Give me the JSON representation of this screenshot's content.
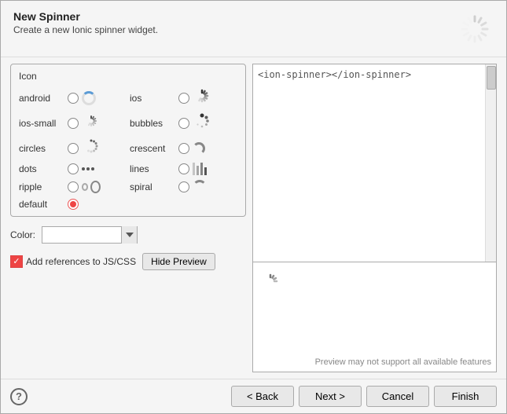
{
  "dialog": {
    "title": "New Spinner",
    "subtitle": "Create a new Ionic spinner widget.",
    "icon_group_label": "Icon",
    "icons": [
      {
        "id": "android",
        "label": "android",
        "col": 0
      },
      {
        "id": "ios",
        "label": "ios",
        "col": 1
      },
      {
        "id": "ios-small",
        "label": "ios-small",
        "col": 0
      },
      {
        "id": "bubbles",
        "label": "bubbles",
        "col": 1
      },
      {
        "id": "circles",
        "label": "circles",
        "col": 0
      },
      {
        "id": "crescent",
        "label": "crescent",
        "col": 1
      },
      {
        "id": "dots",
        "label": "dots",
        "col": 0
      },
      {
        "id": "lines",
        "label": "lines",
        "col": 1
      },
      {
        "id": "ripple",
        "label": "ripple",
        "col": 0
      },
      {
        "id": "spiral",
        "label": "spiral",
        "col": 1
      },
      {
        "id": "default",
        "label": "default",
        "col": 0,
        "selected": true
      }
    ],
    "color_label": "Color:",
    "color_value": "",
    "color_placeholder": "",
    "add_references_label": "Add references to JS/CSS",
    "hide_preview_label": "Hide Preview",
    "code_preview_text": "<ion-spinner></ion-spinner>",
    "preview_note": "Preview may not support all available features",
    "footer": {
      "back_label": "< Back",
      "next_label": "Next >",
      "cancel_label": "Cancel",
      "finish_label": "Finish"
    }
  }
}
